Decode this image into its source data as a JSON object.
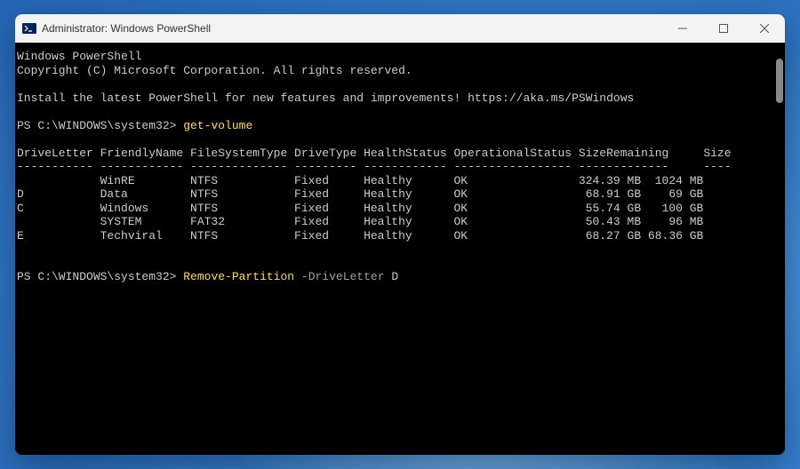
{
  "window": {
    "title": "Administrator: Windows PowerShell"
  },
  "terminal": {
    "header_line1": "Windows PowerShell",
    "header_line2": "Copyright (C) Microsoft Corporation. All rights reserved.",
    "header_line3": "Install the latest PowerShell for new features and improvements! https://aka.ms/PSWindows",
    "prompt_path": "PS C:\\WINDOWS\\system32>",
    "cmd1": "get-volume",
    "table_header": "DriveLetter FriendlyName FileSystemType DriveType HealthStatus OperationalStatus SizeRemaining     Size",
    "table_sep": "----------- ------------ -------------- --------- ------------ ----------------- -------------     ----",
    "rows": [
      {
        "letter": " ",
        "name": "WinRE    ",
        "fs": "NTFS ",
        "dtype": "Fixed",
        "health": "Healthy",
        "op": "OK",
        "remain": "324.39 MB",
        "size": " 1024 MB"
      },
      {
        "letter": "D",
        "name": "Data     ",
        "fs": "NTFS ",
        "dtype": "Fixed",
        "health": "Healthy",
        "op": "OK",
        "remain": " 68.91 GB",
        "size": "   69 GB"
      },
      {
        "letter": "C",
        "name": "Windows  ",
        "fs": "NTFS ",
        "dtype": "Fixed",
        "health": "Healthy",
        "op": "OK",
        "remain": " 55.74 GB",
        "size": "  100 GB"
      },
      {
        "letter": " ",
        "name": "SYSTEM   ",
        "fs": "FAT32",
        "dtype": "Fixed",
        "health": "Healthy",
        "op": "OK",
        "remain": " 50.43 MB",
        "size": "   96 MB"
      },
      {
        "letter": "E",
        "name": "Techviral",
        "fs": "NTFS ",
        "dtype": "Fixed",
        "health": "Healthy",
        "op": "OK",
        "remain": " 68.27 GB",
        "size": "68.36 GB"
      }
    ],
    "cmd2": "Remove-Partition",
    "cmd2_param": "-DriveLetter",
    "cmd2_arg": "D"
  }
}
